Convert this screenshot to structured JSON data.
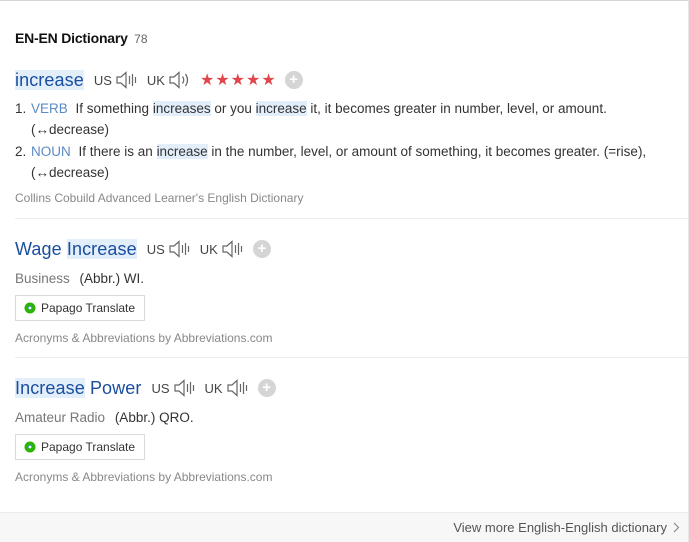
{
  "section": {
    "title": "EN-EN Dictionary",
    "count": "78"
  },
  "entries": [
    {
      "word_parts": [
        {
          "text": "increase",
          "hl": true
        }
      ],
      "us_label": "US",
      "uk_label": "UK",
      "stars": "★★★★★",
      "definitions": [
        {
          "num": "1.",
          "pos": "VERB",
          "segments": [
            {
              "text": "If something ",
              "hl": false
            },
            {
              "text": "increases",
              "hl": true
            },
            {
              "text": " or you ",
              "hl": false
            },
            {
              "text": "increase",
              "hl": true
            },
            {
              "text": " it, it becomes greater in number, level, or amount. (↔decrease)",
              "hl": false
            }
          ]
        },
        {
          "num": "2.",
          "pos": "NOUN",
          "segments": [
            {
              "text": "If there is an ",
              "hl": false
            },
            {
              "text": "increase",
              "hl": true
            },
            {
              "text": " in the number, level, or amount of something, it becomes greater. (=rise), (↔decrease)",
              "hl": false
            }
          ]
        }
      ],
      "source": "Collins Cobuild Advanced Learner's English Dictionary"
    },
    {
      "word_parts": [
        {
          "text": "Wage ",
          "hl": false
        },
        {
          "text": "Increase",
          "hl": true
        }
      ],
      "us_label": "US",
      "uk_label": "UK",
      "field": "Business",
      "abbr": "(Abbr.) WI.",
      "papago_label": "Papago Translate",
      "source": "Acronyms & Abbreviations by Abbreviations.com"
    },
    {
      "word_parts": [
        {
          "text": "Increase",
          "hl": true
        },
        {
          "text": " Power",
          "hl": false
        }
      ],
      "us_label": "US",
      "uk_label": "UK",
      "field": "Amateur Radio",
      "abbr": "(Abbr.) QRO.",
      "papago_label": "Papago Translate",
      "source": "Acronyms & Abbreviations by Abbreviations.com"
    }
  ],
  "footer": {
    "more_label": "View more English-English dictionary"
  },
  "colors": {
    "headword": "#1a4ea0",
    "pos": "#5b8bc5",
    "stars": "#e0474c",
    "highlight": "#e2eefa",
    "papago_green": "#2db400"
  },
  "icons": {
    "speaker": "speaker-icon",
    "plus": "plus-icon",
    "papago": "papago-logo-icon",
    "chevron": "chevron-right-icon"
  }
}
